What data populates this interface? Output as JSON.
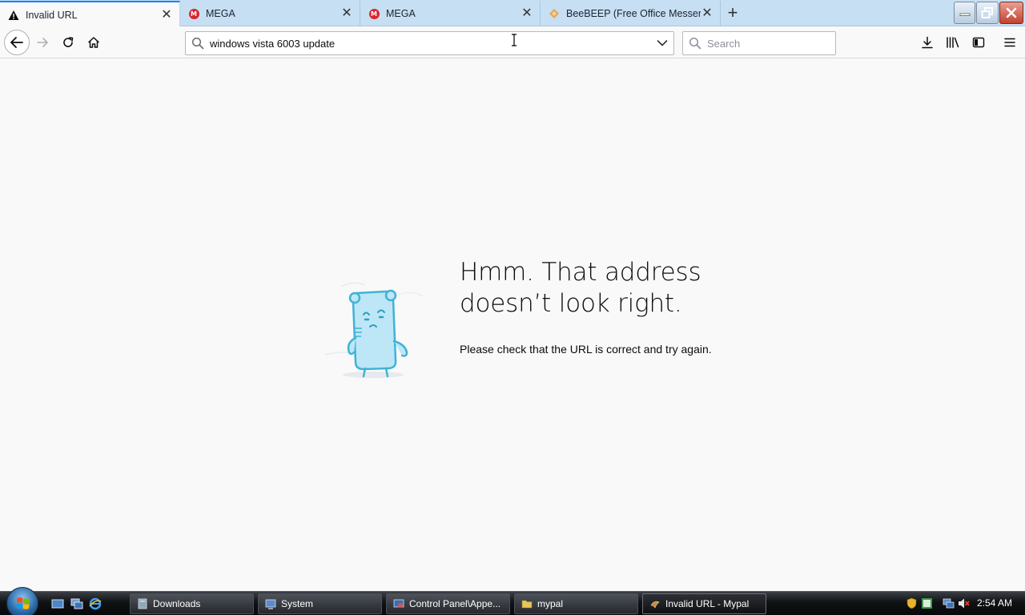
{
  "browser": {
    "tabs": [
      {
        "title": "Invalid URL",
        "active": true,
        "favicon": "warning-icon"
      },
      {
        "title": "MEGA",
        "active": false,
        "favicon": "mega-icon"
      },
      {
        "title": "MEGA",
        "active": false,
        "favicon": "mega-icon"
      },
      {
        "title": "BeeBEEP (Free Office Messenger)",
        "active": false,
        "favicon": "beebeep-icon"
      }
    ],
    "new_tab_label": "+",
    "close_glyph": "✕"
  },
  "navbar": {
    "url_value": "windows vista 6003 update",
    "search_placeholder": "Search"
  },
  "error_page": {
    "title_line1": "Hmm. That address",
    "title_line2": "doesn’t look right.",
    "description": "Please check that the URL is correct and try again."
  },
  "taskbar": {
    "buttons": [
      {
        "label": "Downloads",
        "icon": "folder-icon"
      },
      {
        "label": "System",
        "icon": "system-icon"
      },
      {
        "label": "Control Panel\\Appe...",
        "icon": "control-panel-icon"
      },
      {
        "label": "mypal",
        "icon": "folder-icon"
      },
      {
        "label": "Invalid URL - Mypal",
        "icon": "mypal-icon",
        "active": true
      }
    ],
    "clock": "2:54 AM"
  },
  "colors": {
    "accent": "#0a84ff",
    "tabstrip": "#c7dff3",
    "page_bg": "#f9f9fa"
  }
}
